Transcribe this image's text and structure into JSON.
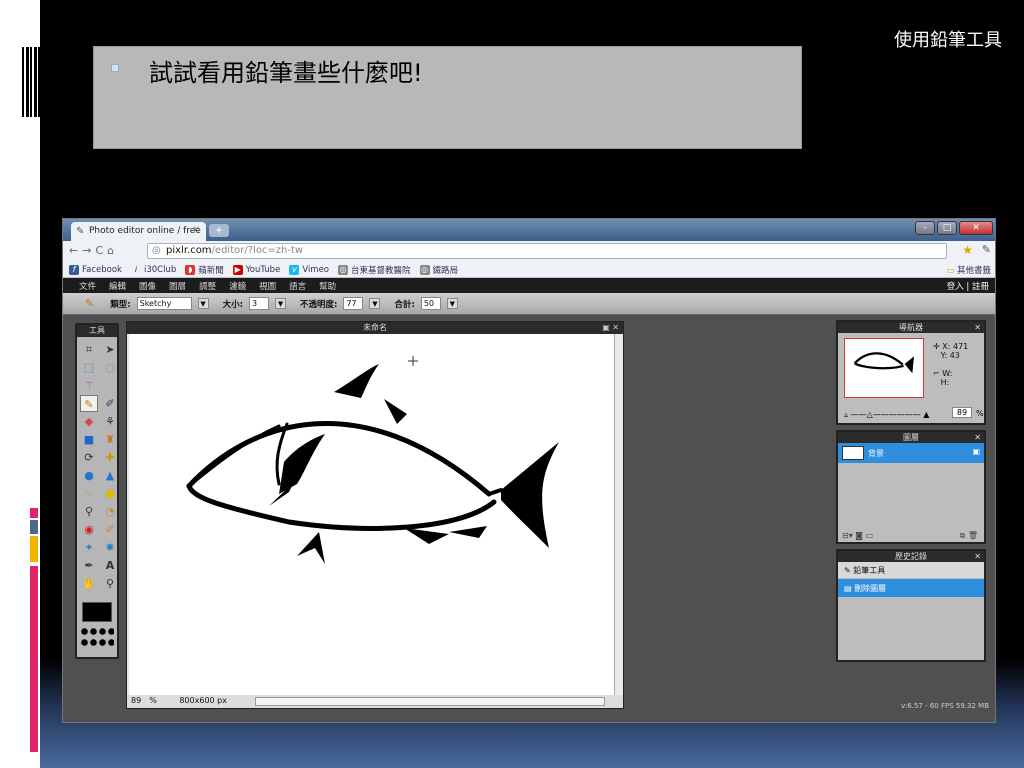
{
  "slide": {
    "title": "使用鉛筆工具",
    "bullet": "試試看用鉛筆畫些什麼吧!"
  },
  "browser": {
    "tab_title": "Photo editor online / free",
    "tab_close": "×",
    "new_tab": "+",
    "url_host": "pixlr.com",
    "url_path": "/editor/?loc=zh-tw",
    "bookmarks": [
      "Facebook",
      "i30Club",
      "蘋新聞",
      "YouTube",
      "Vimeo",
      "台東基督教醫院",
      "鐵路局"
    ],
    "other_bookmarks": "其他書籤"
  },
  "app": {
    "menu": [
      "文件",
      "編輯",
      "圖像",
      "圖層",
      "調整",
      "濾鏡",
      "視圖",
      "語言",
      "幫助"
    ],
    "login": "登入 | 註冊",
    "options": {
      "type_label": "類型:",
      "type_value": "Sketchy",
      "size_label": "大小:",
      "size_value": "3",
      "opacity_label": "不透明度:",
      "opacity_value": "77",
      "blend_label": "合計:",
      "blend_value": "50"
    },
    "tools_title": "工具",
    "canvas_title": "未命名",
    "status_zoom": "89",
    "status_pct": "%",
    "status_size": "800x600 px",
    "navigator": {
      "title": "導航器",
      "x_label": "X:",
      "x_value": "471",
      "y_label": "Y:",
      "y_value": "43",
      "w_label": "W:",
      "h_label": "H:",
      "zoom_value": "89",
      "zoom_unit": "%"
    },
    "layers": {
      "title": "圖層",
      "layer_name": "背景"
    },
    "history": {
      "title": "歷史記錄",
      "items": [
        "鉛筆工具",
        "刪除圖層"
      ]
    },
    "footer": "v:6.57 - 60 FPS 59.32 MB"
  }
}
